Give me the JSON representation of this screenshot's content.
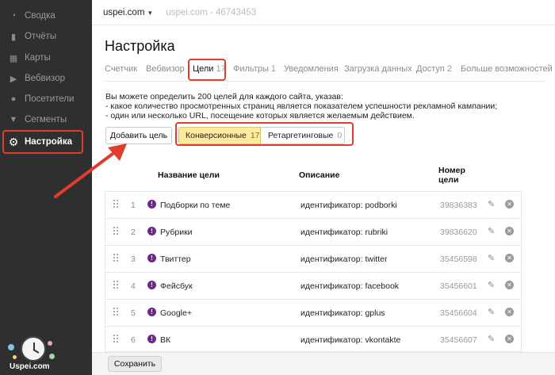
{
  "sidebar": {
    "items": [
      {
        "label": "Сводка",
        "icon": "dashboard-icon",
        "glyph": "◔"
      },
      {
        "label": "Отчёты",
        "icon": "reports-icon",
        "glyph": "▮"
      },
      {
        "label": "Карты",
        "icon": "maps-icon",
        "glyph": "▦"
      },
      {
        "label": "Вебвизор",
        "icon": "play-icon",
        "glyph": "▶"
      },
      {
        "label": "Посетители",
        "icon": "user-icon",
        "glyph": "●"
      },
      {
        "label": "Сегменты",
        "icon": "filter-icon",
        "glyph": "▼"
      },
      {
        "label": "Настройка",
        "icon": "gear-icon",
        "glyph": "⚙"
      }
    ],
    "logo_text": "Uspei.com"
  },
  "topbar": {
    "site": "uspei.com",
    "site_id": "uspei.com - 46743453"
  },
  "page": {
    "title": "Настройка"
  },
  "tabs": [
    {
      "label": "Счетчик",
      "count": ""
    },
    {
      "label": "Вебвизор",
      "count": ""
    },
    {
      "label": "Цели",
      "count": "17"
    },
    {
      "label": "Фильтры",
      "count": "1"
    },
    {
      "label": "Уведомления",
      "count": ""
    },
    {
      "label": "Загрузка данных",
      "count": ""
    },
    {
      "label": "Доступ",
      "count": "2"
    },
    {
      "label": "Больше возможностей",
      "count": ""
    }
  ],
  "info": {
    "line1": "Вы можете определить 200 целей для каждого сайта, указав:",
    "line2": "- какое количество просмотренных страниц является показателем успешности рекламной кампании;",
    "line3": "- один или несколько URL, посещение которых является желаемым действием."
  },
  "actions": {
    "add_goal": "Добавить цель",
    "seg_conv_label": "Конверсионные",
    "seg_conv_count": "17",
    "seg_retarg_label": "Ретаргетинговые",
    "seg_retarg_count": "0"
  },
  "table": {
    "headers": {
      "name": "Название цели",
      "desc": "Описание",
      "id_line1": "Номер",
      "id_line2": "цели"
    },
    "rows": [
      {
        "num": "1",
        "name": "Подборки по теме",
        "desc": "идентификатор: podborki",
        "id": "39836383"
      },
      {
        "num": "2",
        "name": "Рубрики",
        "desc": "идентификатор: rubriki",
        "id": "39836620"
      },
      {
        "num": "3",
        "name": "Твиттер",
        "desc": "идентификатор: twitter",
        "id": "35456598"
      },
      {
        "num": "4",
        "name": "Фейсбук",
        "desc": "идентификатор: facebook",
        "id": "35456601"
      },
      {
        "num": "5",
        "name": "Google+",
        "desc": "идентификатор: gplus",
        "id": "35456604"
      },
      {
        "num": "6",
        "name": "ВК",
        "desc": "идентификатор: vkontakte",
        "id": "35456607"
      }
    ]
  },
  "footer": {
    "save": "Сохранить"
  },
  "colors": {
    "sidebar_bg": "#2f2f2f",
    "highlight_red": "#e03c2f",
    "segment_active": "#ffeba0",
    "warn_purple": "#6b2a86"
  }
}
